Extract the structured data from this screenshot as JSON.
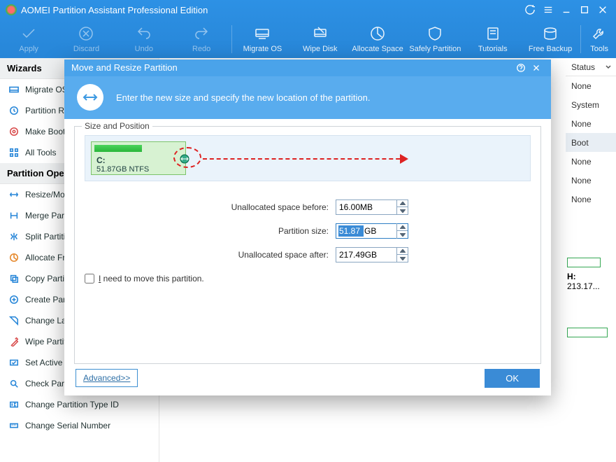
{
  "app_title": "AOMEI Partition Assistant Professional Edition",
  "toolbar": {
    "apply": "Apply",
    "discard": "Discard",
    "undo": "Undo",
    "redo": "Redo",
    "migrate_os": "Migrate OS",
    "wipe_disk": "Wipe Disk",
    "allocate": "Allocate Space",
    "safely": "Safely Partition",
    "tutorials": "Tutorials",
    "backup": "Free Backup",
    "tools": "Tools"
  },
  "sidebar": {
    "wizards_head": "Wizards",
    "wizards": [
      "Migrate OS to SSD",
      "Partition Recovery Wizard",
      "Make Bootable Media",
      "All Tools"
    ],
    "ops_head": "Partition Operations",
    "ops": [
      "Resize/Move Partition",
      "Merge Partitions",
      "Split Partition",
      "Allocate Free Space",
      "Copy Partition",
      "Create Partition",
      "Change Label",
      "Wipe Partition",
      "Set Active Partition",
      "Check Partition",
      "Change Partition Type ID",
      "Change Serial Number"
    ]
  },
  "status": {
    "head": "Status",
    "rows": [
      "None",
      "System",
      "None",
      "Boot",
      "None",
      "None",
      "None"
    ]
  },
  "drive": {
    "letter": "H:",
    "size": "213.17..."
  },
  "modal": {
    "title": "Move and Resize Partition",
    "banner": "Enter the new size and specify the new location of the partition.",
    "legend": "Size and Position",
    "part_letter": "C:",
    "part_info": "51.87GB NTFS",
    "label_before": "Unallocated space before:",
    "val_before": "16.00MB",
    "label_size": "Partition size:",
    "val_size": "51.87",
    "val_size_unit": "GB",
    "label_after": "Unallocated space after:",
    "val_after": "217.49GB",
    "checkbox": "I need to move this partition.",
    "advanced": "Advanced>>",
    "ok": "OK"
  }
}
